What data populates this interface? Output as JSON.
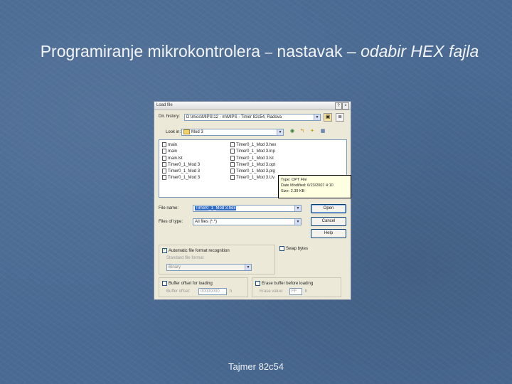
{
  "slide": {
    "title_line1_part1": "Programiranje mikrokontrolera",
    "title_dash_small": "–",
    "title_line1_part2": "nastavak –",
    "title_italic": "odabir HEX fajla",
    "footer": "Tajmer 82c54"
  },
  "dialog": {
    "title": "Load file",
    "help_btn": "?",
    "close_btn": "×",
    "dir_label": "Dir. history:",
    "dir_value": "D:\\mios\\MIPS\\12 - m\\MIPS - Timer 82c54, Radova",
    "look_in_label": "Look in:",
    "look_in_value": "Mod 3",
    "files_left": [
      "main",
      "main",
      "main.lst",
      "Timer0_1_Mod 3",
      "Timer0_1_Mod 3",
      "Timer0_1_Mod 3"
    ],
    "files_right": [
      "Timer0_1_Mod 3.hex",
      "Timer0_1_Mod 3.lnp",
      "Timer0_1_Mod 3.lst",
      "Timer0_1_Mod 3.opt",
      "Timer0_1_Mod 3.plg",
      "Timer0_1_Mod 3.Uv"
    ],
    "tooltip": {
      "line1": "Type: OPT File",
      "line2": "Date Modified: 6/23/2007 4:10",
      "line3": "Size: 2.39 KB"
    },
    "filename_label": "File name:",
    "filename_value": "Timer0_1_Mod 3.hex",
    "filetype_label": "Files of type:",
    "filetype_value": "All files (*.*)",
    "open_btn": "Open",
    "cancel_btn": "Cancel",
    "help_button": "Help",
    "auto_format_label": "Automatic file format recognition",
    "standard_format_label": "Standard file format",
    "format_value": "Binary",
    "swap_bytes_label": "Swap bytes",
    "buffer_offset_label": "Buffer offset for loading",
    "buffer_offset_field_label": "Buffer offset:",
    "buffer_offset_value": "00000000",
    "buffer_offset_unit": "h",
    "erase_buffer_label": "Erase buffer before loading",
    "erase_value_label": "Erase value:",
    "erase_value": "FF",
    "erase_unit": "h"
  }
}
